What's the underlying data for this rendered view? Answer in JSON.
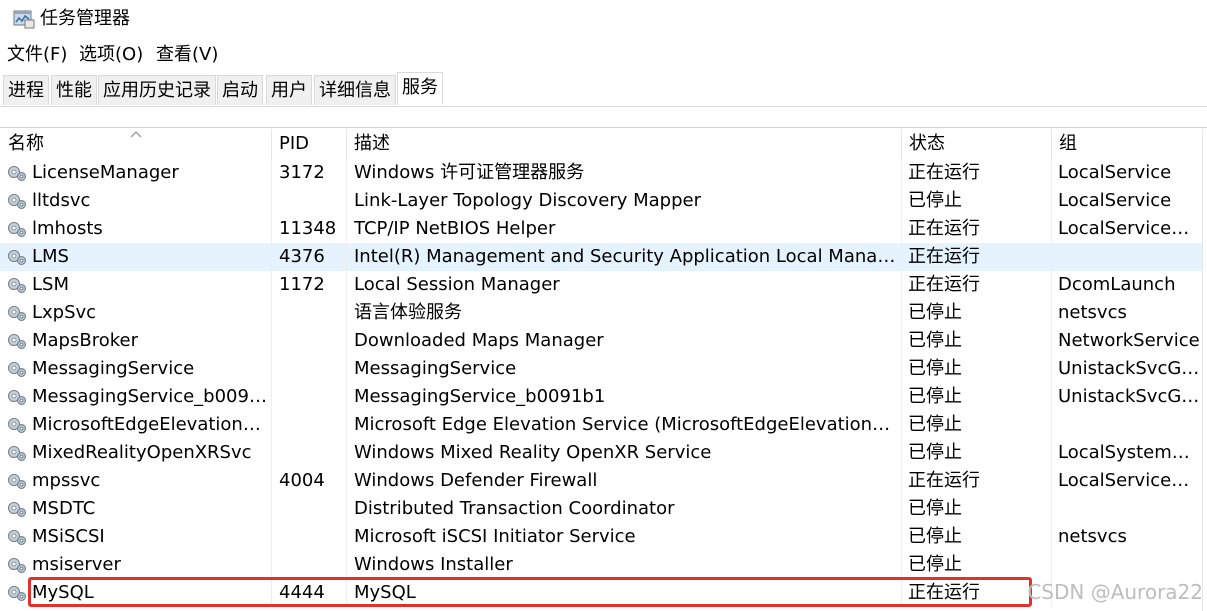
{
  "window": {
    "title": "任务管理器",
    "icon": "task-manager-icon"
  },
  "menu": [
    {
      "label": "文件(F)"
    },
    {
      "label": "选项(O)"
    },
    {
      "label": "查看(V)"
    }
  ],
  "tabs": [
    {
      "label": "进程"
    },
    {
      "label": "性能"
    },
    {
      "label": "应用历史记录"
    },
    {
      "label": "启动"
    },
    {
      "label": "用户"
    },
    {
      "label": "详细信息"
    },
    {
      "label": "服务",
      "active": true
    }
  ],
  "columns": {
    "name": "名称",
    "pid": "PID",
    "description": "描述",
    "status": "状态",
    "group": "组"
  },
  "services": [
    {
      "name": "LicenseManager",
      "pid": "3172",
      "description": "Windows 许可证管理器服务",
      "status": "正在运行",
      "group": "LocalService"
    },
    {
      "name": "lltdsvc",
      "pid": "",
      "description": "Link-Layer Topology Discovery Mapper",
      "status": "已停止",
      "group": "LocalService"
    },
    {
      "name": "lmhosts",
      "pid": "11348",
      "description": "TCP/IP NetBIOS Helper",
      "status": "正在运行",
      "group": "LocalServiceN..."
    },
    {
      "name": "LMS",
      "pid": "4376",
      "description": "Intel(R) Management and Security Application Local Manage...",
      "status": "正在运行",
      "group": ""
    },
    {
      "name": "LSM",
      "pid": "1172",
      "description": "Local Session Manager",
      "status": "正在运行",
      "group": "DcomLaunch"
    },
    {
      "name": "LxpSvc",
      "pid": "",
      "description": "语言体验服务",
      "status": "已停止",
      "group": "netsvcs"
    },
    {
      "name": "MapsBroker",
      "pid": "",
      "description": "Downloaded Maps Manager",
      "status": "已停止",
      "group": "NetworkService"
    },
    {
      "name": "MessagingService",
      "pid": "",
      "description": "MessagingService",
      "status": "已停止",
      "group": "UnistackSvcGr..."
    },
    {
      "name": "MessagingService_b0091...",
      "pid": "",
      "description": "MessagingService_b0091b1",
      "status": "已停止",
      "group": "UnistackSvcGr..."
    },
    {
      "name": "MicrosoftEdgeElevationSe...",
      "pid": "",
      "description": "Microsoft Edge Elevation Service (MicrosoftEdgeElevationSer...",
      "status": "已停止",
      "group": ""
    },
    {
      "name": "MixedRealityOpenXRSvc",
      "pid": "",
      "description": "Windows Mixed Reality OpenXR Service",
      "status": "已停止",
      "group": "LocalSystemN..."
    },
    {
      "name": "mpssvc",
      "pid": "4004",
      "description": "Windows Defender Firewall",
      "status": "正在运行",
      "group": "LocalServiceN..."
    },
    {
      "name": "MSDTC",
      "pid": "",
      "description": "Distributed Transaction Coordinator",
      "status": "已停止",
      "group": ""
    },
    {
      "name": "MSiSCSI",
      "pid": "",
      "description": "Microsoft iSCSI Initiator Service",
      "status": "已停止",
      "group": "netsvcs"
    },
    {
      "name": "msiserver",
      "pid": "",
      "description": "Windows Installer",
      "status": "已停止",
      "group": ""
    },
    {
      "name": "MySQL",
      "pid": "4444",
      "description": "MySQL",
      "status": "正在运行",
      "group": ""
    }
  ],
  "highlight_row": 3,
  "annotated_row": 15,
  "watermark": "CSDN @Aurora22",
  "colors": {
    "hover_row": "#e5f3ff",
    "annotation": "#e0322a"
  }
}
